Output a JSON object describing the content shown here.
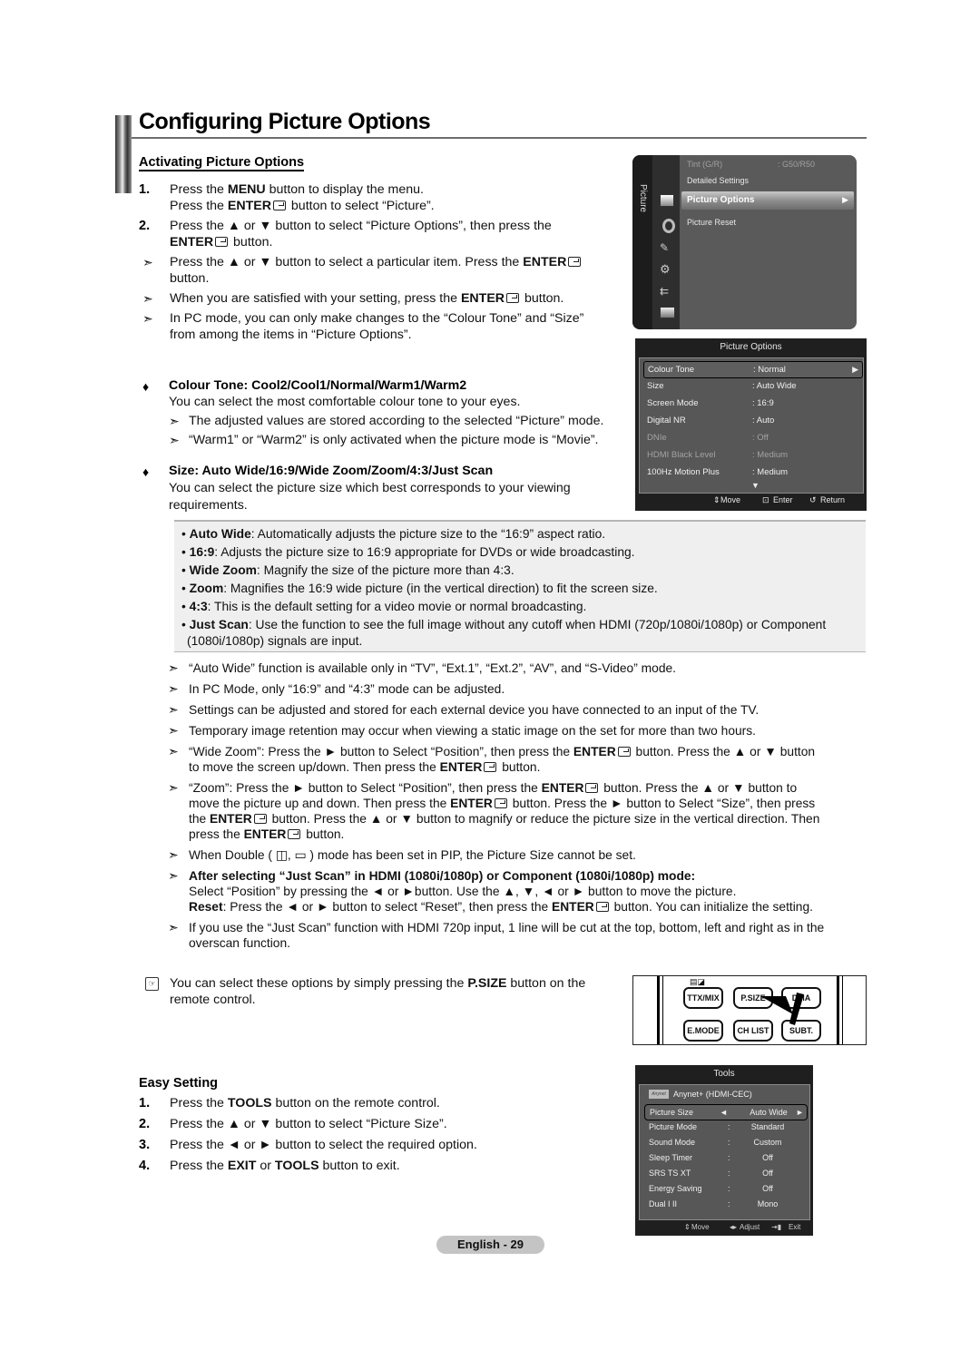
{
  "page": {
    "title": "Configuring Picture Options",
    "page_label": "English - 29"
  },
  "activating": {
    "heading": "Activating Picture Options",
    "steps": [
      {
        "num": "1.",
        "lines": [
          [
            "Press the ",
            {
              "b": "MENU"
            },
            " button to display the menu."
          ],
          [
            "Press the ",
            {
              "b": "ENTER"
            },
            {
              "icon": "enter"
            },
            " button to select “Picture”."
          ]
        ]
      },
      {
        "num": "2.",
        "lines": [
          [
            "Press the ▲ or ▼ button to select “Picture Options”, then press the"
          ],
          [
            {
              "b": "ENTER"
            },
            {
              "icon": "enter"
            },
            " button."
          ]
        ]
      }
    ],
    "notes": [
      {
        "lines": [
          [
            "Press the ▲ or ▼ button to select a particular item. Press the ",
            {
              "b": "ENTER"
            },
            {
              "icon": "enter"
            }
          ],
          [
            "button."
          ]
        ]
      },
      {
        "lines": [
          [
            "When you are satisfied with your setting, press the ",
            {
              "b": "ENTER"
            },
            {
              "icon": "enter"
            },
            " button."
          ]
        ]
      },
      {
        "lines": [
          [
            "In PC mode, you can only make changes to the “Colour Tone” and “Size”"
          ],
          [
            "from among the items in “Picture Options”."
          ]
        ]
      }
    ]
  },
  "colour_tone": {
    "heading": "Colour Tone: Cool2/Cool1/Normal/Warm1/Warm2",
    "desc": "You can select the most comfortable colour tone to your eyes.",
    "notes": [
      "The adjusted values are stored according to the selected “Picture” mode.",
      "“Warm1” or “Warm2” is only activated when the picture mode is “Movie”."
    ]
  },
  "size": {
    "heading": "Size: Auto Wide/16:9/Wide Zoom/Zoom/4:3/Just Scan",
    "desc_lines": [
      "You can select the picture size which best corresponds to your viewing",
      "requirements."
    ],
    "options": [
      {
        "term": "Auto Wide",
        "text": ": Automatically adjusts the picture size to the “16:9” aspect ratio."
      },
      {
        "term": "16:9",
        "text": ": Adjusts the picture size to 16:9 appropriate for DVDs or wide broadcasting."
      },
      {
        "term": "Wide Zoom",
        "text": ": Magnify the size of the picture more than 4:3."
      },
      {
        "term": "Zoom",
        "text": ": Magnifies the 16:9 wide picture (in the vertical direction) to fit the screen size."
      },
      {
        "term": "4:3",
        "text": ": This is the default setting for a video movie or normal broadcasting."
      },
      {
        "term": "Just Scan",
        "text": ": Use the function to see the full image without any cutoff when HDMI (720p/1080i/1080p) or Component",
        "text2": "(1080i/1080p) signals are input."
      }
    ]
  },
  "caveats": [
    {
      "lines": [
        [
          "“Auto Wide” function is available only in “TV”, “Ext.1”, “Ext.2”, “AV”, and “S-Video” mode."
        ]
      ]
    },
    {
      "lines": [
        [
          "In PC Mode, only “16:9” and “4:3” mode can be adjusted."
        ]
      ]
    },
    {
      "lines": [
        [
          "Settings can be adjusted and stored for each external device you have connected to an input of the TV."
        ]
      ]
    },
    {
      "lines": [
        [
          "Temporary image retention may occur when viewing a static image on the set for more than two hours."
        ]
      ]
    },
    {
      "lines": [
        [
          "“Wide Zoom”: Press the ► button to Select “Position”, then press the ",
          {
            "b": "ENTER"
          },
          {
            "icon": "enter"
          },
          " button. Press the ▲ or ▼ button"
        ],
        [
          "to move the screen up/down. Then press the ",
          {
            "b": "ENTER"
          },
          {
            "icon": "enter"
          },
          " button."
        ]
      ]
    },
    {
      "lines": [
        [
          "“Zoom”: Press the ► button to Select “Position”, then press the ",
          {
            "b": "ENTER"
          },
          {
            "icon": "enter"
          },
          " button. Press the ▲ or ▼ button to"
        ],
        [
          "move the picture up and down. Then press the ",
          {
            "b": "ENTER"
          },
          {
            "icon": "enter"
          },
          " button. Press the ► button to Select “Size”, then press"
        ],
        [
          "the ",
          {
            "b": "ENTER"
          },
          {
            "icon": "enter"
          },
          " button. Press the ▲ or ▼ button to magnify or reduce the picture size in the vertical direction. Then"
        ],
        [
          "press the ",
          {
            "b": "ENTER"
          },
          {
            "icon": "enter"
          },
          " button."
        ]
      ]
    },
    {
      "lines": [
        [
          "When Double ( ◫, ▭ ) mode has been set in PIP, the Picture Size cannot be set."
        ]
      ]
    },
    {
      "lines": [
        [
          {
            "b": "After selecting “Just Scan” in HDMI (1080i/1080p) or Component (1080i/1080p) mode:"
          }
        ],
        [
          "Select “Position” by pressing the ◄ or ►button. Use the ▲, ▼, ◄ or ► button to move the picture."
        ],
        [
          {
            "b": "Reset"
          },
          ": Press the ◄ or ► button to select “Reset”, then press the ",
          {
            "b": "ENTER"
          },
          {
            "icon": "enter"
          },
          " button. You can initialize the setting."
        ]
      ]
    },
    {
      "lines": [
        [
          "If you use the “Just Scan” function with HDMI 720p input, 1 line will be cut at the top, bottom, left and right as in the"
        ],
        [
          "overscan function."
        ]
      ]
    }
  ],
  "psize_note": {
    "lines": [
      [
        "You can select these options by simply pressing the ",
        {
          "b": "P.SIZE"
        },
        " button on the"
      ],
      [
        "remote control."
      ]
    ]
  },
  "easy_setting": {
    "heading": "Easy Setting",
    "steps": [
      {
        "num": "1.",
        "parts": [
          "Press the ",
          {
            "b": "TOOLS"
          },
          " button on the remote control."
        ]
      },
      {
        "num": "2.",
        "parts": [
          "Press the ▲ or ▼ button to select “Picture Size”."
        ]
      },
      {
        "num": "3.",
        "parts": [
          "Press the ◄ or ► button to select the required option."
        ]
      },
      {
        "num": "4.",
        "parts": [
          "Press the ",
          {
            "b": "EXIT"
          },
          " or ",
          {
            "b": "TOOLS"
          },
          " button to exit."
        ]
      }
    ]
  },
  "tv_menu_picture": {
    "category": "Picture",
    "items": [
      {
        "label": "Tint (G/R)",
        "value": ": G50/R50",
        "dim": true
      },
      {
        "label": "Detailed Settings",
        "value": ""
      },
      {
        "label": "Picture Options",
        "value": "",
        "selected": true
      },
      {
        "label": "Picture Reset",
        "value": ""
      }
    ],
    "icons": [
      "picture-icon",
      "sound-icon",
      "channel-icon",
      "setup-icon",
      "input-icon",
      "application-icon"
    ]
  },
  "tv_menu_options": {
    "title": "Picture Options",
    "rows": [
      {
        "label": "Colour Tone",
        "value": ": Normal",
        "selected": true
      },
      {
        "label": "Size",
        "value": ": Auto Wide"
      },
      {
        "label": "Screen Mode",
        "value": ": 16:9"
      },
      {
        "label": "Digital NR",
        "value": ": Auto"
      },
      {
        "label": "DNIe",
        "value": ": Off",
        "dim": true
      },
      {
        "label": "HDMI Black Level",
        "value": ": Medium",
        "dim": true
      },
      {
        "label": "100Hz Motion Plus",
        "value": ": Medium"
      }
    ],
    "footer": {
      "move": "Move",
      "enter": "Enter",
      "return": "Return"
    }
  },
  "remote": {
    "buttons": [
      "TTX/MIX",
      "P.SIZE",
      "DMA",
      "E.MODE",
      "CH LIST",
      "SUBT."
    ]
  },
  "tools_menu": {
    "title": "Tools",
    "anynet": "Anynet+ (HDMI-CEC)",
    "anynet_logo": "Anynet",
    "rows": [
      {
        "label": "Picture Size",
        "value": "Auto Wide",
        "selected": true
      },
      {
        "label": "Picture Mode",
        "value": "Standard"
      },
      {
        "label": "Sound Mode",
        "value": "Custom"
      },
      {
        "label": "Sleep Timer",
        "value": "Off"
      },
      {
        "label": "SRS TS XT",
        "value": "Off"
      },
      {
        "label": "Energy Saving",
        "value": "Off"
      },
      {
        "label": "Dual I II",
        "value": "Mono"
      }
    ],
    "footer": {
      "move": "Move",
      "adjust": "Adjust",
      "exit": "Exit"
    }
  }
}
